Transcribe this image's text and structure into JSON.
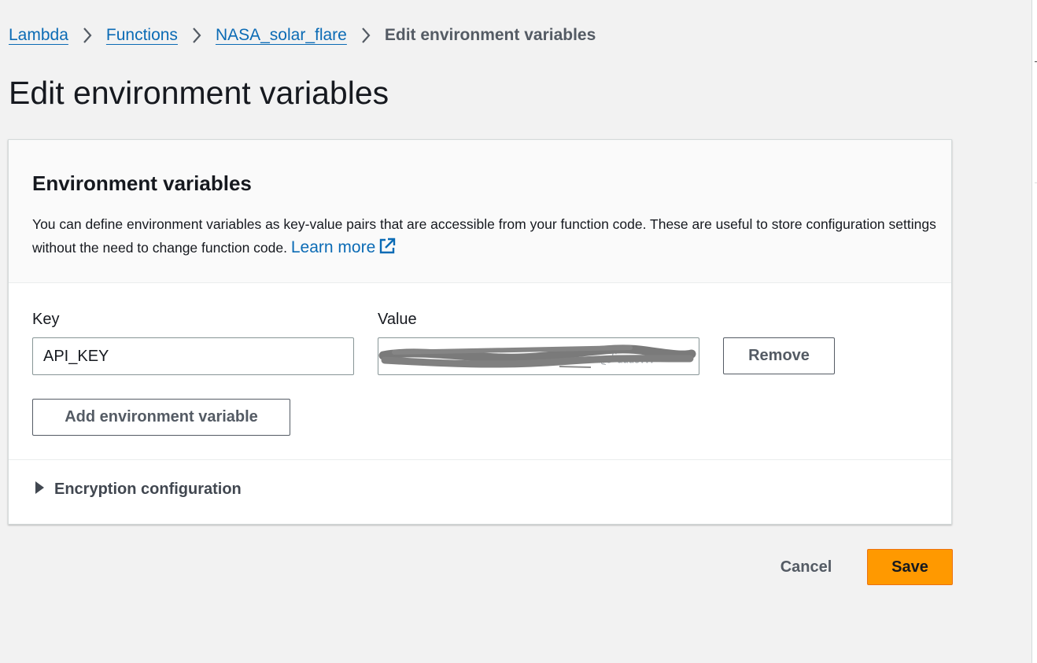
{
  "breadcrumb": {
    "items": [
      {
        "label": "Lambda"
      },
      {
        "label": "Functions"
      },
      {
        "label": "NASA_solar_flare"
      }
    ],
    "current": "Edit environment variables"
  },
  "page": {
    "title": "Edit environment variables"
  },
  "panel": {
    "title": "Environment variables",
    "description": "You can define environment variables as key-value pairs that are accessible from your function code. These are useful to store configuration settings without the need to change function code.",
    "learn_more": "Learn more",
    "key_label": "Key",
    "value_label": "Value",
    "variables": [
      {
        "key": "API_KEY",
        "value": "",
        "value_redacted": true
      }
    ],
    "remove_label": "Remove",
    "add_label": "Add environment variable",
    "encryption_label": "Encryption configuration"
  },
  "actions": {
    "cancel_label": "Cancel",
    "save_label": "Save"
  },
  "colors": {
    "link": "#0b6bb5",
    "primary": "#ff9900",
    "background": "#f2f2f2",
    "redaction": "#808080"
  },
  "icons": {
    "breadcrumb_separator": "chevron-right-icon",
    "external_link": "external-link-icon",
    "expander": "caret-right-icon"
  }
}
